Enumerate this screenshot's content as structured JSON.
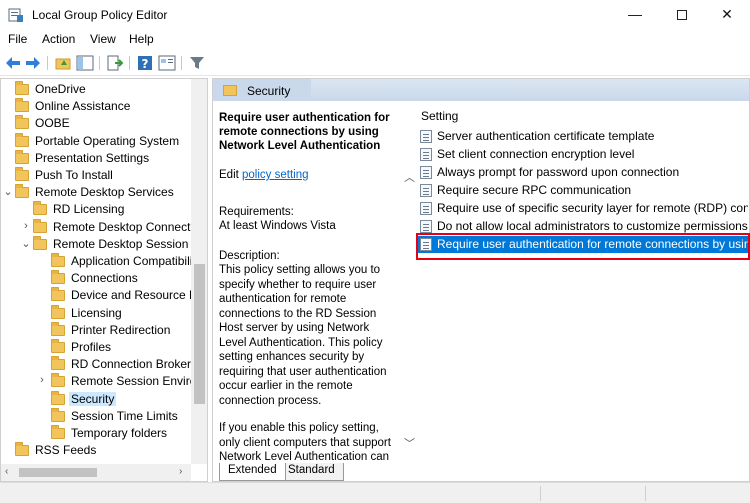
{
  "window": {
    "title": "Local Group Policy Editor",
    "minimize": "—",
    "close": "✕"
  },
  "menu": [
    "File",
    "Action",
    "View",
    "Help"
  ],
  "tree": {
    "items": [
      {
        "label": "OneDrive",
        "level": 0,
        "expander": ""
      },
      {
        "label": "Online Assistance",
        "level": 0,
        "expander": ""
      },
      {
        "label": "OOBE",
        "level": 0,
        "expander": ""
      },
      {
        "label": "Portable Operating System",
        "level": 0,
        "expander": ""
      },
      {
        "label": "Presentation Settings",
        "level": 0,
        "expander": ""
      },
      {
        "label": "Push To Install",
        "level": 0,
        "expander": ""
      },
      {
        "label": "Remote Desktop Services",
        "level": 0,
        "expander": "⌄"
      },
      {
        "label": "RD Licensing",
        "level": 1,
        "expander": ""
      },
      {
        "label": "Remote Desktop Connectio",
        "level": 1,
        "expander": "›"
      },
      {
        "label": "Remote Desktop Session Ho",
        "level": 1,
        "expander": "⌄"
      },
      {
        "label": "Application Compatibili",
        "level": 2,
        "expander": ""
      },
      {
        "label": "Connections",
        "level": 2,
        "expander": ""
      },
      {
        "label": "Device and Resource Re",
        "level": 2,
        "expander": ""
      },
      {
        "label": "Licensing",
        "level": 2,
        "expander": ""
      },
      {
        "label": "Printer Redirection",
        "level": 2,
        "expander": ""
      },
      {
        "label": "Profiles",
        "level": 2,
        "expander": ""
      },
      {
        "label": "RD Connection Broker",
        "level": 2,
        "expander": ""
      },
      {
        "label": "Remote Session Environ",
        "level": 2,
        "expander": "›"
      },
      {
        "label": "Security",
        "level": 2,
        "expander": "",
        "selected": true
      },
      {
        "label": "Session Time Limits",
        "level": 2,
        "expander": ""
      },
      {
        "label": "Temporary folders",
        "level": 2,
        "expander": ""
      },
      {
        "label": "RSS Feeds",
        "level": 0,
        "expander": ""
      }
    ]
  },
  "right": {
    "header": "Security",
    "extended": {
      "title": "Require user authentication for remote connections by using Network Level Authentication",
      "edit_prefix": "Edit ",
      "edit_link": "policy setting",
      "requirements_label": "Requirements:",
      "requirements_value": "At least Windows Vista",
      "description_label": "Description:",
      "description": "This policy setting allows you to specify whether to require user authentication for remote connections to the RD Session Host server by using Network Level Authentication. This policy setting enhances security by requiring that user authentication occur earlier in the remote connection process.",
      "description_2": "If you enable this policy setting, only client computers that support Network Level Authentication can connect to the"
    },
    "column_header": "Setting",
    "settings": [
      "Server authentication certificate template",
      "Set client connection encryption level",
      "Always prompt for password upon connection",
      "Require secure RPC communication",
      "Require use of specific security layer for remote (RDP) conn...",
      "Do not allow local administrators to customize permissions",
      "Require user authentication for remote connections by usin..."
    ],
    "selected_setting_index": 6,
    "tabs": [
      "Extended",
      "Standard"
    ]
  },
  "colors": {
    "selection": "#0078d7",
    "highlight_box": "#e60012",
    "folder": "#f2c55c"
  }
}
